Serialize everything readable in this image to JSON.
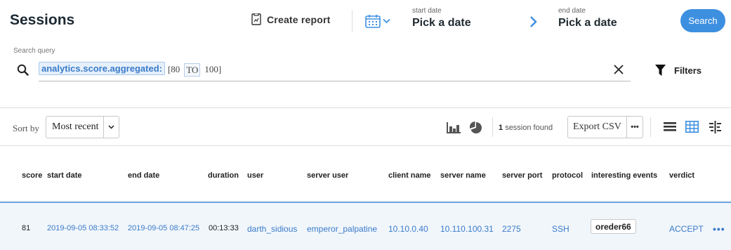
{
  "header": {
    "title": "Sessions",
    "create_report_label": "Create report",
    "start_date": {
      "caption": "start date",
      "value": "Pick a date"
    },
    "end_date": {
      "caption": "end date",
      "value": "Pick a date"
    },
    "search_label": "Search"
  },
  "search_query": {
    "caption": "Search query",
    "field_chip": "analytics.score.aggregated:",
    "open": "[80",
    "keyword": "TO",
    "close": "100]"
  },
  "filters_label": "Filters",
  "toolbar": {
    "sort_by_label": "Sort by",
    "sort_value": "Most recent",
    "session_count": "1",
    "session_count_suffix": "session found",
    "export_label": "Export CSV",
    "export_more": "•••"
  },
  "table": {
    "headers": {
      "score": "score",
      "start_date": "start date",
      "end_date": "end date",
      "duration": "duration",
      "user": "user",
      "server_user": "server user",
      "client_name": "client name",
      "server_name": "server name",
      "server_port": "server port",
      "protocol": "protocol",
      "interesting_events": "interesting events",
      "verdict": "verdict"
    },
    "rows": [
      {
        "score": "81",
        "start_date": "2019-09-05 08:33:52",
        "end_date": "2019-09-05 08:47:25",
        "duration": "00:13:33",
        "user": "darth_sidious",
        "server_user": "emperor_palpatine",
        "client_name": "10.10.0.40",
        "server_name": "10.110.100.31",
        "server_port": "2275",
        "protocol": "SSH",
        "interesting_events": "oreder66",
        "verdict": "ACCEPT",
        "more": "•••"
      }
    ]
  },
  "colors": {
    "accent": "#3d8fe0",
    "link": "#3a7bc8",
    "row_highlight": "#f1f6fb"
  },
  "icons": {
    "create_report": "report-document-icon",
    "calendar": "calendar-icon",
    "next": "chevron-right-icon",
    "search": "search-icon",
    "clear": "close-icon",
    "filter": "funnel-icon",
    "bar_chart": "bar-chart-icon",
    "pie_chart": "pie-chart-icon",
    "list_view": "list-view-icon",
    "grid_view": "grid-view-icon",
    "column_view": "column-settings-icon"
  }
}
